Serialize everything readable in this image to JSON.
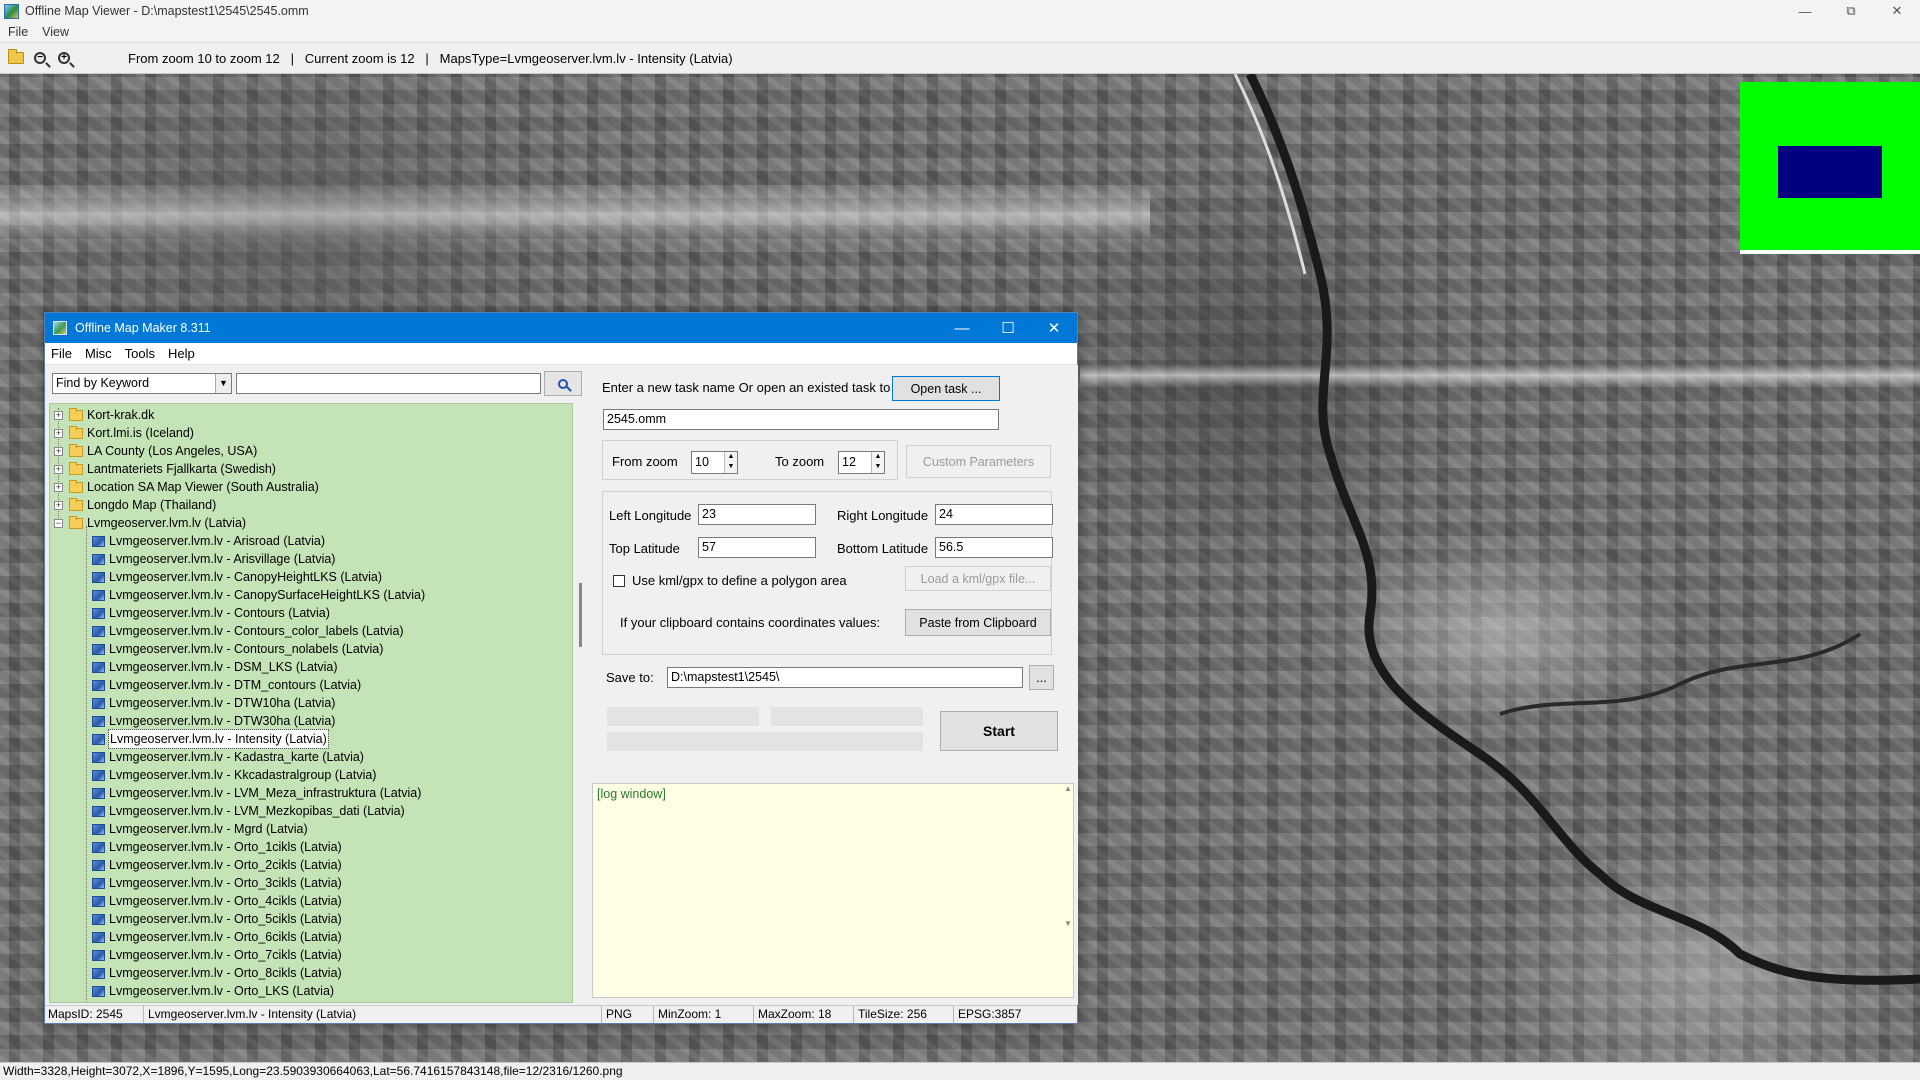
{
  "viewer": {
    "title": "Offline Map Viewer - D:\\mapstest1\\2545\\2545.omm",
    "menu": [
      "File",
      "View"
    ],
    "toolbar_info": "From zoom 10 to zoom 12   |   Current zoom is 12   |   MapsType=Lvmgeoserver.lvm.lv - Intensity (Latvia)",
    "status": "Width=3328,Height=3072,X=1896,Y=1595,Long=23.5903930664063,Lat=56.7416157843148,file=12/2316/1260.png",
    "icons": [
      "open-folder-icon",
      "zoom-out-icon",
      "zoom-in-icon"
    ],
    "minimap_color": "#00ff00",
    "minimap_viewport_color": "#000080"
  },
  "dialog": {
    "title": "Offline Map Maker 8.311",
    "menu": [
      "File",
      "Misc",
      "Tools",
      "Help"
    ],
    "find_mode": "Find by Keyword",
    "search_value": "",
    "tree": {
      "folders": [
        "Kort-krak.dk",
        "Kort.lmi.is (Iceland)",
        "LA County (Los Angeles, USA)",
        "Lantmateriets Fjallkarta (Swedish)",
        "Location SA Map Viewer (South Australia)",
        "Longdo Map (Thailand)"
      ],
      "open_folder": "Lvmgeoserver.lvm.lv (Latvia)",
      "items": [
        "Lvmgeoserver.lvm.lv - Arisroad (Latvia)",
        "Lvmgeoserver.lvm.lv - Arisvillage (Latvia)",
        "Lvmgeoserver.lvm.lv - CanopyHeightLKS (Latvia)",
        "Lvmgeoserver.lvm.lv - CanopySurfaceHeightLKS (Latvia)",
        "Lvmgeoserver.lvm.lv - Contours (Latvia)",
        "Lvmgeoserver.lvm.lv - Contours_color_labels (Latvia)",
        "Lvmgeoserver.lvm.lv - Contours_nolabels (Latvia)",
        "Lvmgeoserver.lvm.lv - DSM_LKS (Latvia)",
        "Lvmgeoserver.lvm.lv - DTM_contours (Latvia)",
        "Lvmgeoserver.lvm.lv - DTW10ha (Latvia)",
        "Lvmgeoserver.lvm.lv - DTW30ha (Latvia)",
        "Lvmgeoserver.lvm.lv - Intensity (Latvia)",
        "Lvmgeoserver.lvm.lv - Kadastra_karte (Latvia)",
        "Lvmgeoserver.lvm.lv - Kkcadastralgroup (Latvia)",
        "Lvmgeoserver.lvm.lv - LVM_Meza_infrastruktura (Latvia)",
        "Lvmgeoserver.lvm.lv - LVM_Mezkopibas_dati (Latvia)",
        "Lvmgeoserver.lvm.lv - Mgrd (Latvia)",
        "Lvmgeoserver.lvm.lv - Orto_1cikls (Latvia)",
        "Lvmgeoserver.lvm.lv - Orto_2cikls (Latvia)",
        "Lvmgeoserver.lvm.lv - Orto_3cikls (Latvia)",
        "Lvmgeoserver.lvm.lv - Orto_4cikls (Latvia)",
        "Lvmgeoserver.lvm.lv - Orto_5cikls (Latvia)",
        "Lvmgeoserver.lvm.lv - Orto_6cikls (Latvia)",
        "Lvmgeoserver.lvm.lv - Orto_7cikls (Latvia)",
        "Lvmgeoserver.lvm.lv - Orto_8cikls (Latvia)",
        "Lvmgeoserver.lvm.lv - Orto_LKS (Latvia)"
      ],
      "selected": "Lvmgeoserver.lvm.lv - Intensity (Latvia)"
    },
    "task_prompt": "Enter a new task name Or open an existed task to continue:",
    "open_task_label": "Open task ...",
    "task_name": "2545.omm",
    "from_zoom_label": "From zoom",
    "from_zoom_value": "10",
    "to_zoom_label": "To zoom",
    "to_zoom_value": "12",
    "custom_params_label": "Custom Parameters",
    "left_lon_label": "Left Longitude",
    "left_lon_value": "23",
    "right_lon_label": "Right Longitude",
    "right_lon_value": "24",
    "top_lat_label": "Top Latitude",
    "top_lat_value": "57",
    "bottom_lat_label": "Bottom Latitude",
    "bottom_lat_value": "56.5",
    "kml_checkbox_label": "Use kml/gpx to define a polygon area",
    "kml_checked": false,
    "load_kml_label": "Load a kml/gpx file...",
    "clipboard_text": "If your clipboard contains coordinates values:",
    "paste_label": "Paste from Clipboard",
    "save_to_label": "Save to:",
    "save_to_value": "D:\\mapstest1\\2545\\",
    "browse_label": "...",
    "start_label": "Start",
    "log_text": "[log window]",
    "status": {
      "maps_id": "MapsID: 2545",
      "map_name": "Lvmgeoserver.lvm.lv - Intensity (Latvia)",
      "format": "PNG",
      "min_zoom": "MinZoom: 1",
      "max_zoom": "MaxZoom: 18",
      "tile_size": "TileSize: 256",
      "epsg": "EPSG:3857"
    }
  }
}
